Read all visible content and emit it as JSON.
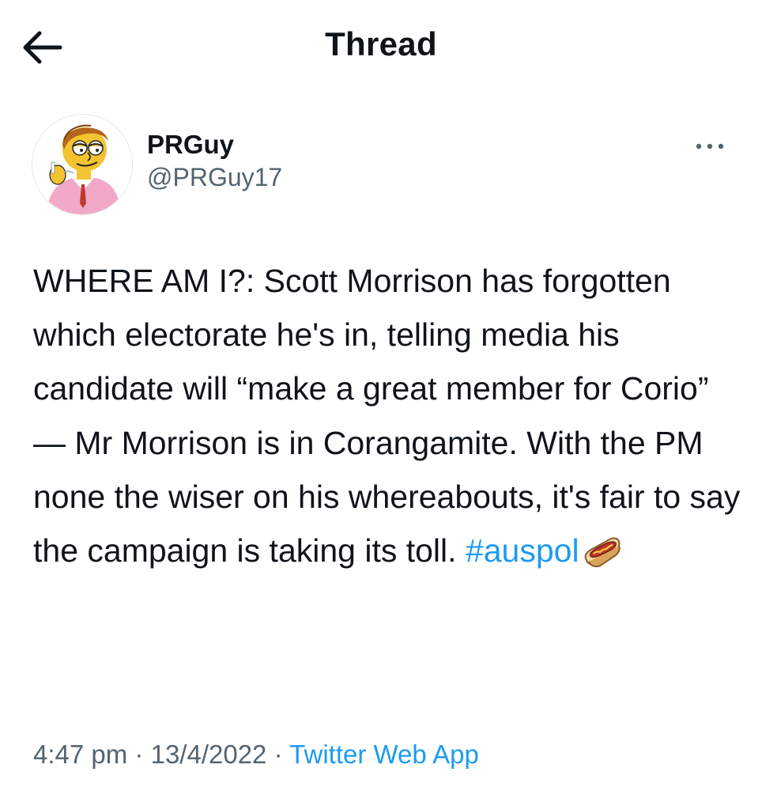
{
  "header": {
    "back_icon": "arrow-left-icon",
    "title": "Thread"
  },
  "tweet": {
    "author": {
      "name": "PRGuy",
      "handle": "@PRGuy17",
      "avatar_icon": "cartoon-man-avatar"
    },
    "more_icon": "more-horizontal-icon",
    "text": "WHERE AM I?: Scott Morrison has forgotten which electorate he's in, telling media his candidate will “make a great member for Corio” — Mr Morrison is in Corangamite.  With the PM none the wiser on his whereabouts, it's fair to say the campaign is taking its toll. ",
    "hashtag": "#auspol",
    "emoji_icon": "hotdog-sandwich-emoji",
    "time": "4:47 pm",
    "separator": "·",
    "date": "13/4/2022",
    "source": "Twitter Web App"
  },
  "colors": {
    "text": "#0f1419",
    "secondary": "#536471",
    "link": "#1d9bf0",
    "background": "#ffffff"
  }
}
